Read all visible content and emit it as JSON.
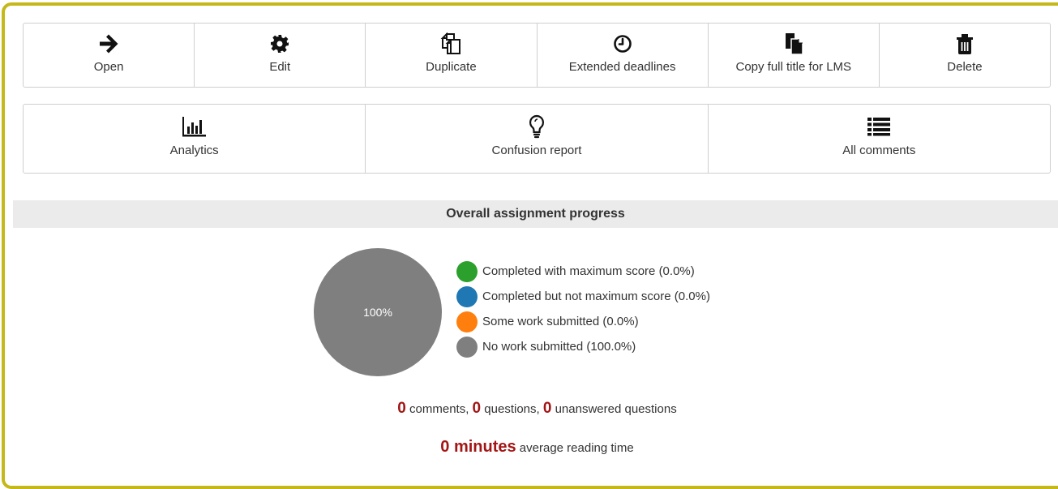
{
  "actions": [
    {
      "label": "Open",
      "icon": "arrow-right-icon"
    },
    {
      "label": "Edit",
      "icon": "gear-icon"
    },
    {
      "label": "Duplicate",
      "icon": "duplicate-icon"
    },
    {
      "label": "Extended deadlines",
      "icon": "clock-icon"
    },
    {
      "label": "Copy full title for LMS",
      "icon": "copy-file-icon"
    },
    {
      "label": "Delete",
      "icon": "trash-icon"
    }
  ],
  "tools": [
    {
      "label": "Analytics",
      "icon": "bar-chart-icon"
    },
    {
      "label": "Confusion report",
      "icon": "lightbulb-icon"
    },
    {
      "label": "All comments",
      "icon": "list-icon"
    }
  ],
  "progress": {
    "title": "Overall assignment progress",
    "pie_label": "100%",
    "legend": [
      {
        "label": "Completed with maximum score (0.0%)",
        "color": "#2ca02c"
      },
      {
        "label": "Completed but not maximum score (0.0%)",
        "color": "#1f77b4"
      },
      {
        "label": "Some work submitted (0.0%)",
        "color": "#ff7f0e"
      },
      {
        "label": "No work submitted (100.0%)",
        "color": "#7f7f7f"
      }
    ]
  },
  "chart_data": {
    "type": "pie",
    "categories": [
      "Completed with maximum score",
      "Completed but not maximum score",
      "Some work submitted",
      "No work submitted"
    ],
    "values": [
      0.0,
      0.0,
      0.0,
      100.0
    ],
    "colors": [
      "#2ca02c",
      "#1f77b4",
      "#ff7f0e",
      "#7f7f7f"
    ]
  },
  "stats": {
    "comments_count": "0",
    "comments_label": " comments, ",
    "questions_count": "0",
    "questions_label": " questions, ",
    "unanswered_count": "0",
    "unanswered_label": " unanswered questions"
  },
  "reading": {
    "value": "0 minutes",
    "label": " average reading time"
  }
}
